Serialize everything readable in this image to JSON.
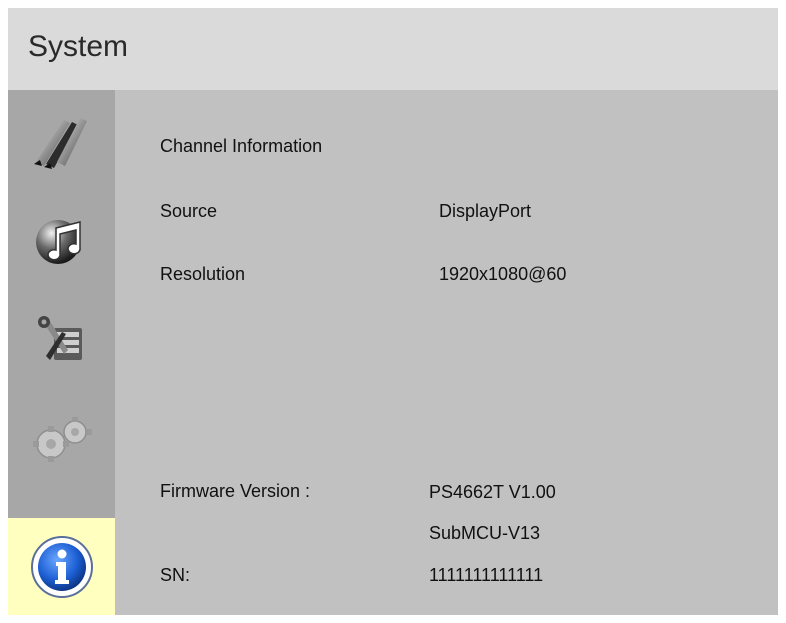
{
  "header": {
    "title": "System"
  },
  "sidebar": {
    "items": [
      {
        "icon": "picture-brushes-icon",
        "active": false
      },
      {
        "icon": "audio-music-icon",
        "active": false
      },
      {
        "icon": "tools-settings-icon",
        "active": false
      },
      {
        "icon": "gears-icon",
        "active": false
      },
      {
        "icon": "info-icon",
        "active": true
      }
    ],
    "active_color": "#ffffc0"
  },
  "info": {
    "section_title": "Channel Information",
    "source_label": "Source",
    "source_value": "DisplayPort",
    "resolution_label": "Resolution",
    "resolution_value": "1920x1080@60",
    "firmware_label": "Firmware Version :",
    "firmware_value": "PS4662T V1.00",
    "submcu_value": "SubMCU-V13",
    "sn_label": "SN:",
    "sn_value": "1111111111111"
  }
}
